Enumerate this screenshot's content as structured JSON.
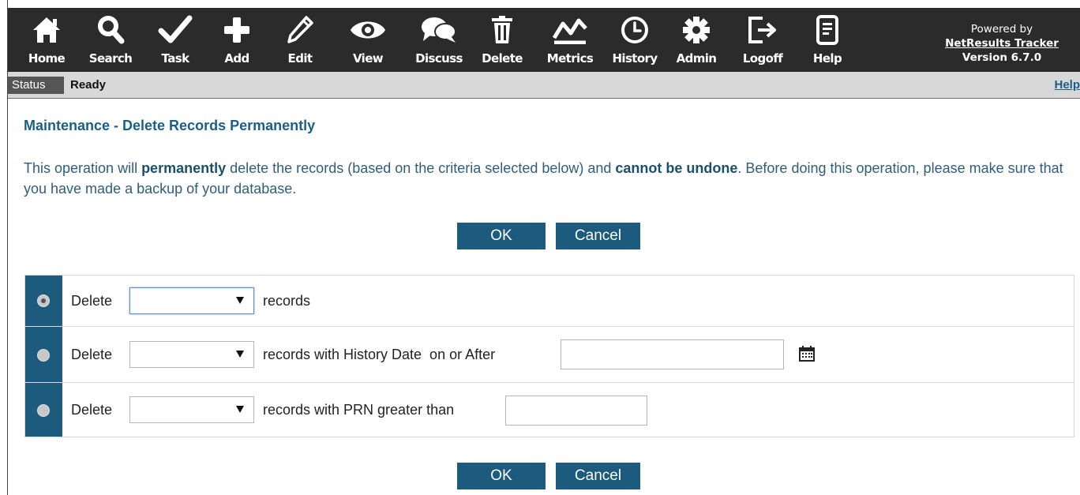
{
  "toolbar": {
    "items": [
      {
        "label": "Home",
        "icon": "home-icon"
      },
      {
        "label": "Search",
        "icon": "search-icon"
      },
      {
        "label": "Task",
        "icon": "check-icon"
      },
      {
        "label": "Add",
        "icon": "plus-icon"
      },
      {
        "label": "Edit",
        "icon": "pencil-icon"
      },
      {
        "label": "View",
        "icon": "eye-icon"
      },
      {
        "label": "Discuss",
        "icon": "chat-icon"
      },
      {
        "label": "Delete",
        "icon": "trash-icon"
      },
      {
        "label": "Metrics",
        "icon": "chart-icon"
      },
      {
        "label": "History",
        "icon": "clock-icon"
      },
      {
        "label": "Admin",
        "icon": "gear-icon"
      },
      {
        "label": "Logoff",
        "icon": "logoff-icon"
      },
      {
        "label": "Help",
        "icon": "document-icon"
      }
    ],
    "powered_by": "Powered by",
    "product_link": "NetResults Tracker",
    "version": "Version 6.7.0"
  },
  "status": {
    "label": "Status",
    "value": "Ready",
    "help": "Help"
  },
  "main": {
    "title": "Maintenance - Delete Records Permanently",
    "warning": {
      "part1": "This operation will ",
      "bold1": "permanently",
      "part2": " delete the records (based on the criteria selected below) and ",
      "bold2": "cannot be undone",
      "part3": ". Before doing this operation, please make sure that you have made a backup of your database."
    },
    "ok_label": "OK",
    "cancel_label": "Cancel",
    "options": [
      {
        "checked": true,
        "prefix": "Delete",
        "select_value": "",
        "suffix": "records"
      },
      {
        "checked": false,
        "prefix": "Delete",
        "select_value": "",
        "suffix": "records with History Date  on or After",
        "input_value": ""
      },
      {
        "checked": false,
        "prefix": "Delete",
        "select_value": "",
        "suffix": "records with PRN greater than",
        "input_value": ""
      }
    ]
  },
  "colors": {
    "toolbar_bg": "#2b2b2b",
    "accent": "#1c5a7e",
    "title": "#1b5f86",
    "statusbar_bg": "#d8d8d8"
  }
}
